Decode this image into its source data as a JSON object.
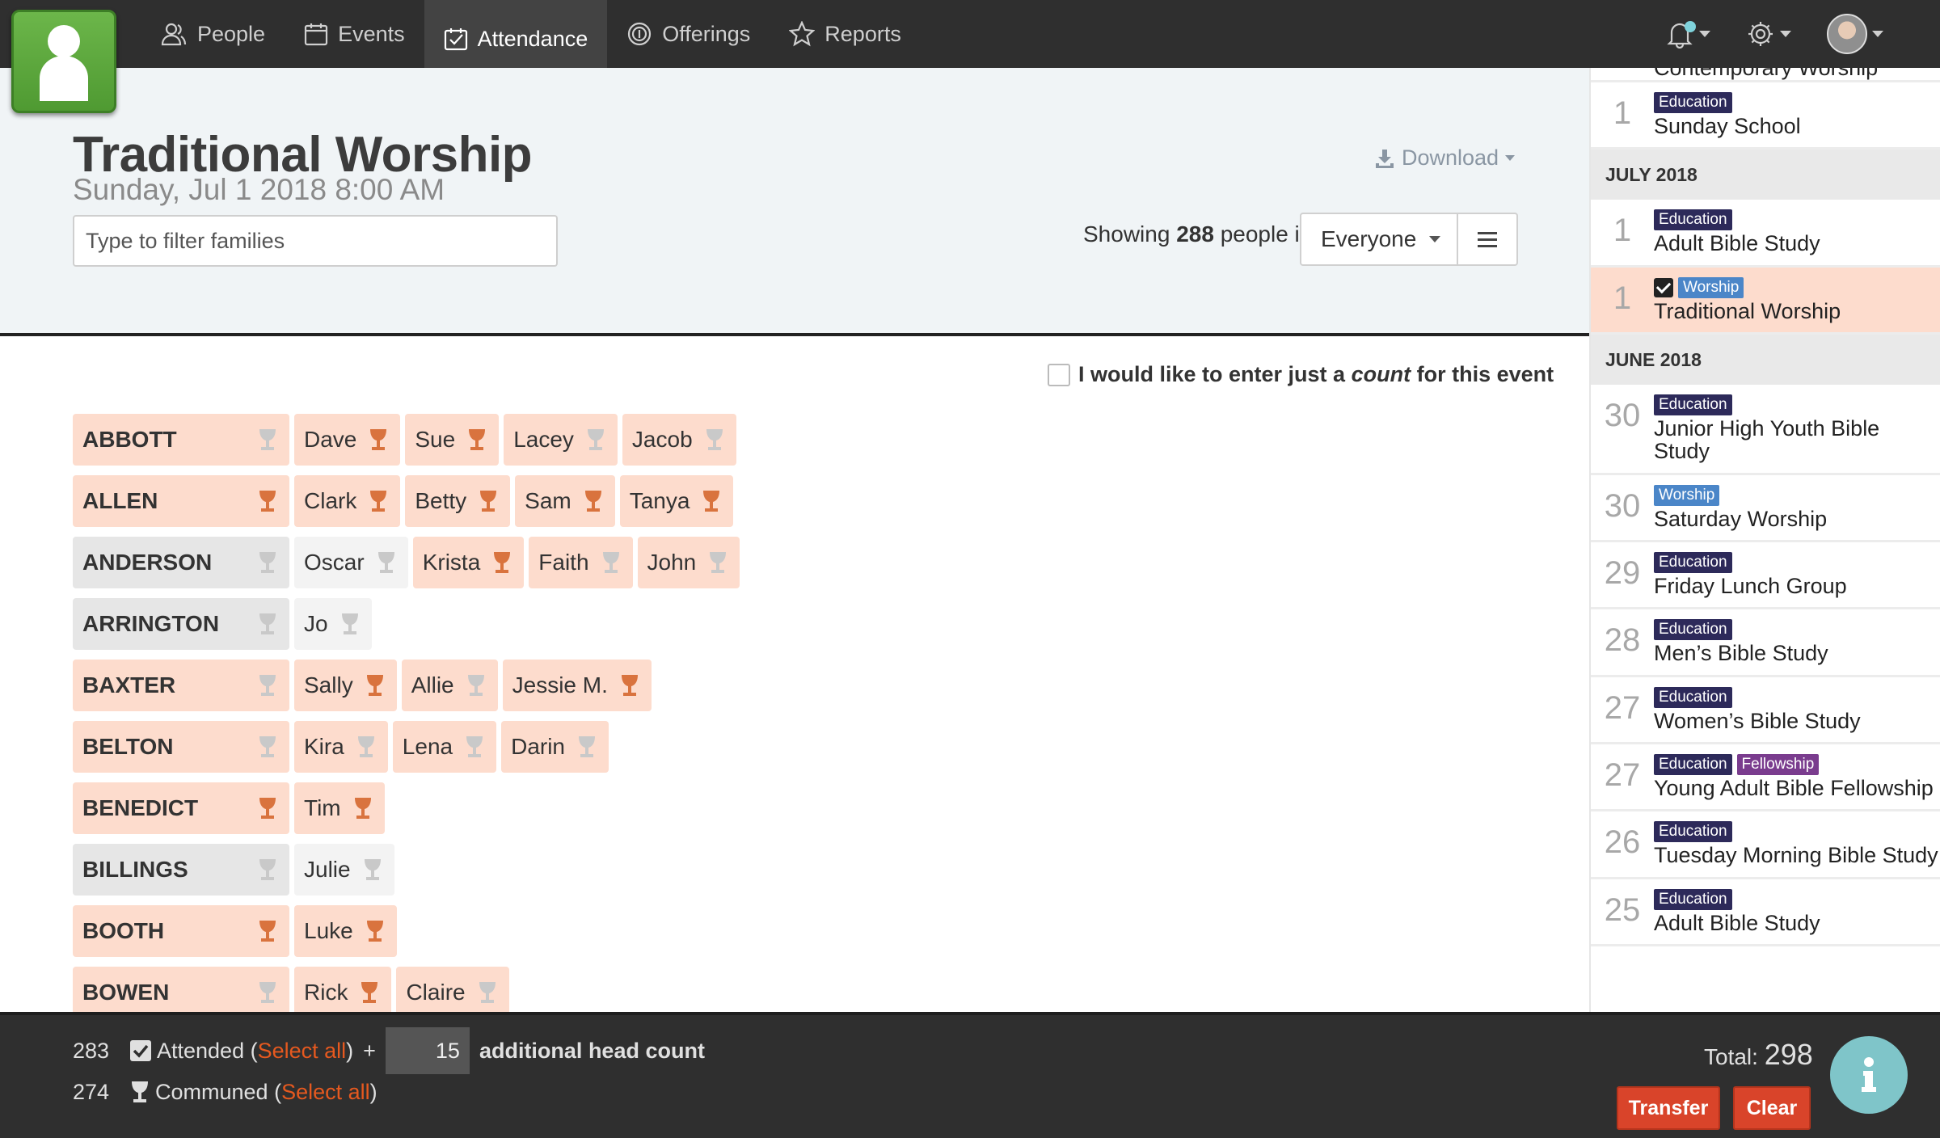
{
  "nav": {
    "items": [
      {
        "label": "People",
        "icon": "people-icon"
      },
      {
        "label": "Events",
        "icon": "calendar-icon"
      },
      {
        "label": "Attendance",
        "icon": "checkbox-icon"
      },
      {
        "label": "Offerings",
        "icon": "coin-icon"
      },
      {
        "label": "Reports",
        "icon": "star-icon"
      }
    ],
    "active": "Attendance"
  },
  "header": {
    "title": "Traditional Worship",
    "subtitle": "Sunday, Jul 1 2018 8:00 AM",
    "filter_placeholder": "Type to filter families",
    "download_label": "Download",
    "showing_prefix": "Showing",
    "showing_count": "288",
    "showing_suffix": "people in",
    "group_select": "Everyone"
  },
  "count_option": {
    "prefix": "I would like to enter just a",
    "emph": "count",
    "suffix": "for this event"
  },
  "families": [
    {
      "name": "ABBOTT",
      "on": true,
      "communed": false,
      "members": [
        {
          "name": "Dave",
          "on": true,
          "communed": true
        },
        {
          "name": "Sue",
          "on": true,
          "communed": true
        },
        {
          "name": "Lacey",
          "on": true,
          "communed": false
        },
        {
          "name": "Jacob",
          "on": true,
          "communed": false
        }
      ]
    },
    {
      "name": "ALLEN",
      "on": true,
      "communed": true,
      "members": [
        {
          "name": "Clark",
          "on": true,
          "communed": true
        },
        {
          "name": "Betty",
          "on": true,
          "communed": true
        },
        {
          "name": "Sam",
          "on": true,
          "communed": true
        },
        {
          "name": "Tanya",
          "on": true,
          "communed": true
        }
      ]
    },
    {
      "name": "ANDERSON",
      "on": false,
      "communed": false,
      "members": [
        {
          "name": "Oscar",
          "on": false,
          "communed": false
        },
        {
          "name": "Krista",
          "on": true,
          "communed": true
        },
        {
          "name": "Faith",
          "on": true,
          "communed": false
        },
        {
          "name": "John",
          "on": true,
          "communed": false
        }
      ]
    },
    {
      "name": "ARRINGTON",
      "on": false,
      "communed": false,
      "members": [
        {
          "name": "Jo",
          "on": false,
          "communed": false
        }
      ]
    },
    {
      "name": "BAXTER",
      "on": true,
      "communed": false,
      "members": [
        {
          "name": "Sally",
          "on": true,
          "communed": true
        },
        {
          "name": "Allie",
          "on": true,
          "communed": false
        },
        {
          "name": "Jessie M.",
          "on": true,
          "communed": true
        }
      ]
    },
    {
      "name": "BELTON",
      "on": true,
      "communed": false,
      "members": [
        {
          "name": "Kira",
          "on": true,
          "communed": false
        },
        {
          "name": "Lena",
          "on": true,
          "communed": false
        },
        {
          "name": "Darin",
          "on": true,
          "communed": false
        }
      ]
    },
    {
      "name": "BENEDICT",
      "on": true,
      "communed": true,
      "members": [
        {
          "name": "Tim",
          "on": true,
          "communed": true
        }
      ]
    },
    {
      "name": "BILLINGS",
      "on": false,
      "communed": false,
      "members": [
        {
          "name": "Julie",
          "on": false,
          "communed": false
        }
      ]
    },
    {
      "name": "BOOTH",
      "on": true,
      "communed": true,
      "members": [
        {
          "name": "Luke",
          "on": true,
          "communed": true
        }
      ]
    },
    {
      "name": "BOWEN",
      "on": true,
      "communed": false,
      "members": [
        {
          "name": "Rick",
          "on": true,
          "communed": true
        },
        {
          "name": "Claire",
          "on": true,
          "communed": false
        }
      ]
    }
  ],
  "sidebar": {
    "partial_top": "Contemporary Worship",
    "groups": [
      {
        "month": "",
        "items": [
          {
            "day": "1",
            "tags": [
              "Education"
            ],
            "checked": false,
            "name": "Sunday School",
            "selected": false
          }
        ]
      },
      {
        "month": "JULY 2018",
        "items": [
          {
            "day": "1",
            "tags": [
              "Education"
            ],
            "checked": false,
            "name": "Adult Bible Study",
            "selected": false
          },
          {
            "day": "1",
            "tags": [
              "Worship"
            ],
            "checked": true,
            "name": "Traditional Worship",
            "selected": true
          }
        ]
      },
      {
        "month": "JUNE 2018",
        "items": [
          {
            "day": "30",
            "tags": [
              "Education"
            ],
            "checked": false,
            "name": "Junior High Youth Bible Study",
            "selected": false
          },
          {
            "day": "30",
            "tags": [
              "Worship"
            ],
            "checked": false,
            "name": "Saturday Worship",
            "selected": false
          },
          {
            "day": "29",
            "tags": [
              "Education"
            ],
            "checked": false,
            "name": "Friday Lunch Group",
            "selected": false
          },
          {
            "day": "28",
            "tags": [
              "Education"
            ],
            "checked": false,
            "name": "Men’s Bible Study",
            "selected": false
          },
          {
            "day": "27",
            "tags": [
              "Education"
            ],
            "checked": false,
            "name": "Women’s Bible Study",
            "selected": false
          },
          {
            "day": "27",
            "tags": [
              "Education",
              "Fellowship"
            ],
            "checked": false,
            "name": "Young Adult Bible Fellowship",
            "selected": false
          },
          {
            "day": "26",
            "tags": [
              "Education"
            ],
            "checked": false,
            "name": "Tuesday Morning Bible Study",
            "selected": false
          },
          {
            "day": "25",
            "tags": [
              "Education"
            ],
            "checked": false,
            "name": "Adult Bible Study",
            "selected": false
          }
        ]
      }
    ]
  },
  "footer": {
    "attended_count": "283",
    "attended_label": "Attended (",
    "communed_count": "274",
    "communed_label": "Communed (",
    "select_all": "Select all",
    "close_paren": ")",
    "plus": "+",
    "headcount_value": "15",
    "headcount_label": "additional head count",
    "total_label": "Total:",
    "total_value": "298",
    "transfer_label": "Transfer",
    "clear_label": "Clear"
  },
  "colors": {
    "accent": "#7fc5c9",
    "present": "#fddccd",
    "absent": "#f3f3f3",
    "communion": "#d9733e",
    "action": "#d9442a",
    "tag_education": "#2d2a5a",
    "tag_worship": "#4b86c8",
    "tag_fellowship": "#7a3c8e"
  }
}
